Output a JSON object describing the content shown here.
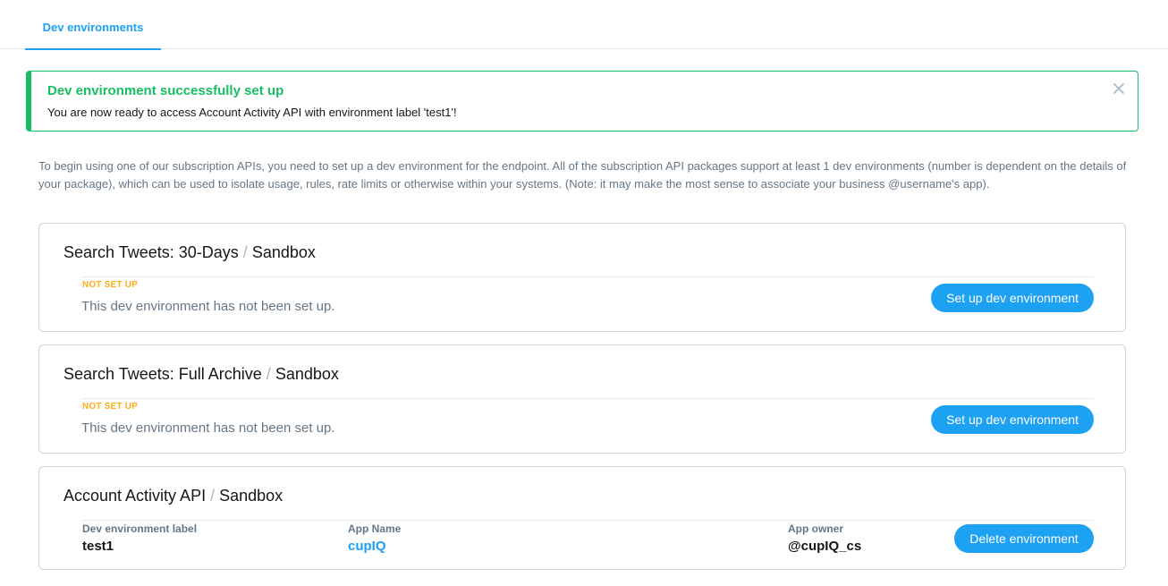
{
  "tabs": [
    {
      "label": "Dev environments"
    }
  ],
  "alert": {
    "title": "Dev environment successfully set up",
    "message": "You are now ready to access Account Activity API with environment label 'test1'!"
  },
  "intro": "To begin using one of our subscription APIs, you need to set up a dev environment for the endpoint. All of the subscription API packages support at least 1 dev environments (number is dependent on the details of your package), which can be used to isolate usage, rules, rate limits or otherwise within your systems. (Note: it may make the most sense to associate your business @username's app).",
  "environments": [
    {
      "name": "Search Tweets: 30-Days",
      "separator": "/",
      "tier": "Sandbox",
      "status": "NOT SET UP",
      "status_message": "This dev environment has not been set up.",
      "button_label": "Set up dev environment"
    },
    {
      "name": "Search Tweets: Full Archive",
      "separator": "/",
      "tier": "Sandbox",
      "status": "NOT SET UP",
      "status_message": "This dev environment has not been set up.",
      "button_label": "Set up dev environment"
    },
    {
      "name": "Account Activity API",
      "separator": "/",
      "tier": "Sandbox",
      "fields": {
        "label_title": "Dev environment label",
        "label_value": "test1",
        "app_title": "App Name",
        "app_value": "cupIQ",
        "owner_title": "App owner",
        "owner_value": "@cupIQ_cs"
      },
      "button_label": "Delete environment"
    }
  ],
  "colors": {
    "accent": "#1da1f2",
    "success": "#17bf63",
    "warning": "#ffad1f",
    "muted": "#657786"
  },
  "icons": {
    "alert_close": "close-icon"
  }
}
